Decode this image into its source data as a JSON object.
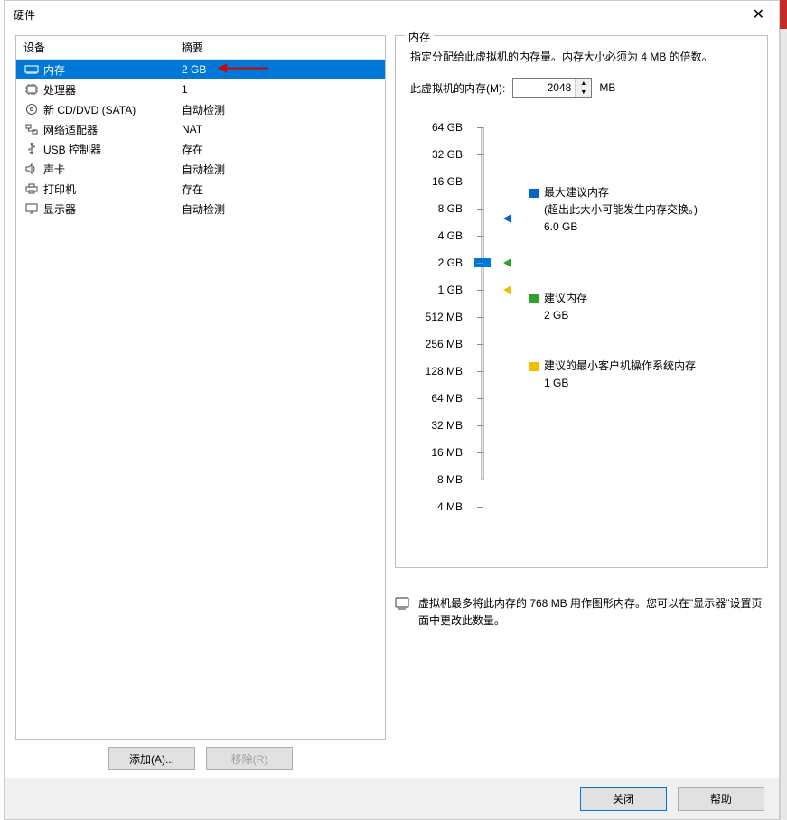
{
  "dialog": {
    "title": "硬件",
    "close_button": "close"
  },
  "list": {
    "header_device": "设备",
    "header_summary": "摘要",
    "rows": [
      {
        "icon": "memory",
        "name": "内存",
        "summary": "2 GB",
        "selected": true,
        "annotated_arrow": true
      },
      {
        "icon": "cpu",
        "name": "处理器",
        "summary": "1"
      },
      {
        "icon": "disc",
        "name": "新 CD/DVD (SATA)",
        "summary": "自动检测"
      },
      {
        "icon": "network",
        "name": "网络适配器",
        "summary": "NAT"
      },
      {
        "icon": "usb",
        "name": "USB 控制器",
        "summary": "存在"
      },
      {
        "icon": "sound",
        "name": "声卡",
        "summary": "自动检测"
      },
      {
        "icon": "printer",
        "name": "打印机",
        "summary": "存在"
      },
      {
        "icon": "display",
        "name": "显示器",
        "summary": "自动检测"
      }
    ]
  },
  "left_buttons": {
    "add": "添加(A)...",
    "remove": "移除(R)"
  },
  "memory_panel": {
    "legend": "内存",
    "description": "指定分配给此虚拟机的内存量。内存大小必须为 4 MB 的倍数。",
    "input_label": "此虚拟机的内存(M):",
    "input_value": "2048",
    "unit": "MB",
    "ticks": [
      "64 GB",
      "32 GB",
      "16 GB",
      "8 GB",
      "4 GB",
      "2 GB",
      "1 GB",
      "512 MB",
      "256 MB",
      "128 MB",
      "64 MB",
      "32 MB",
      "16 MB",
      "8 MB",
      "4 MB"
    ],
    "slider_value_index": 5,
    "markers": {
      "max": {
        "color": "#0066cc",
        "position_index": 3.35,
        "label_title": "最大建议内存",
        "label_note": "(超出此大小可能发生内存交换。)",
        "label_value": "6.0 GB"
      },
      "rec": {
        "color": "#2ea02e",
        "position_index": 5,
        "label_title": "建议内存",
        "label_value": "2 GB"
      },
      "min": {
        "color": "#f0c000",
        "position_index": 6,
        "label_title": "建议的最小客户机操作系统内存",
        "label_value": "1 GB"
      }
    },
    "info_note": "虚拟机最多将此内存的 768 MB 用作图形内存。您可以在\"显示器\"设置页面中更改此数量。"
  },
  "bottom": {
    "close": "关闭",
    "help": "帮助"
  }
}
